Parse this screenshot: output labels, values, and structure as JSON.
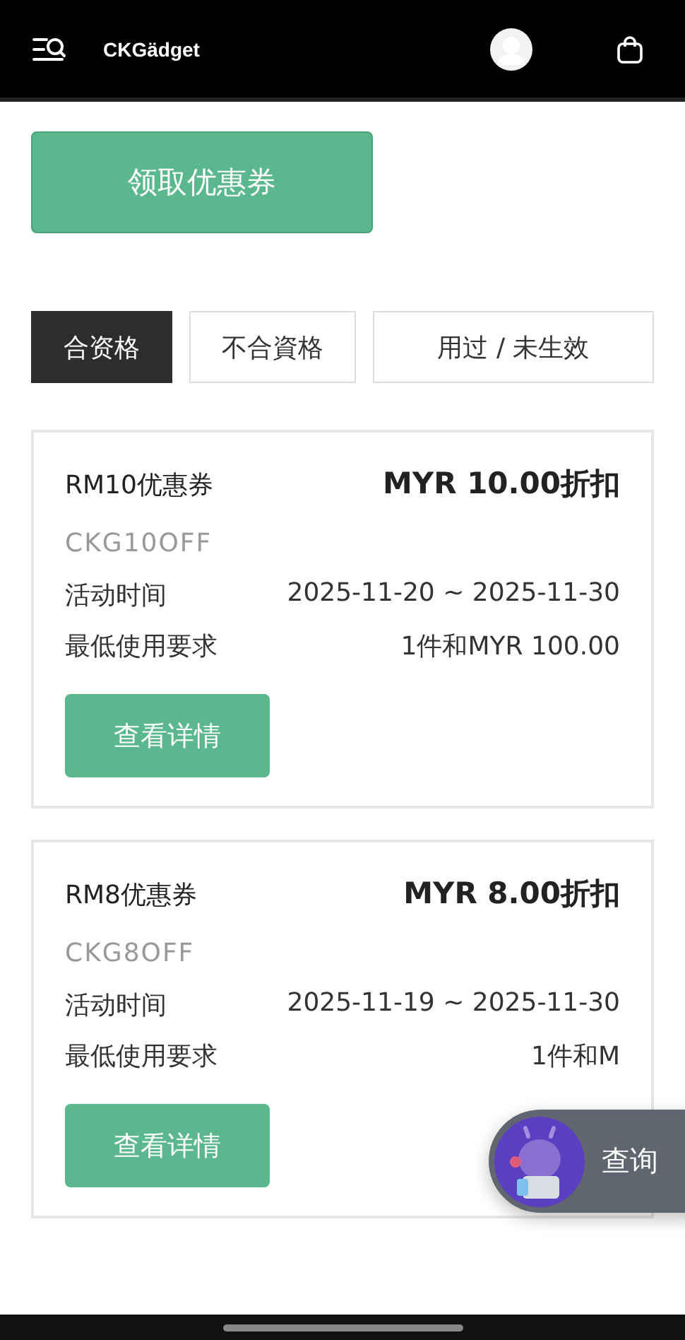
{
  "header": {
    "brand": "CKGädget"
  },
  "claim_button": "领取优惠券",
  "tabs": [
    {
      "label": "合资格",
      "selected": true
    },
    {
      "label": "不合資格",
      "selected": false
    },
    {
      "label": "用过 / 未生效",
      "selected": false
    }
  ],
  "coupons": [
    {
      "name": "RM10优惠券",
      "discount": "MYR 10.00折扣",
      "code": "CKG10OFF",
      "rows": [
        {
          "label": "活动时间",
          "value": "2025-11-20 ~ 2025-11-30"
        },
        {
          "label": "最低使用要求",
          "value": "1件和MYR 100.00"
        }
      ],
      "button": "查看详情"
    },
    {
      "name": "RM8优惠券",
      "discount": "MYR 8.00折扣",
      "code": "CKG8OFF",
      "rows": [
        {
          "label": "活动时间",
          "value": "2025-11-19 ~ 2025-11-30"
        },
        {
          "label": "最低使用要求",
          "value": "1件和M"
        }
      ],
      "button": "查看详情"
    }
  ],
  "chat_button": "查询"
}
